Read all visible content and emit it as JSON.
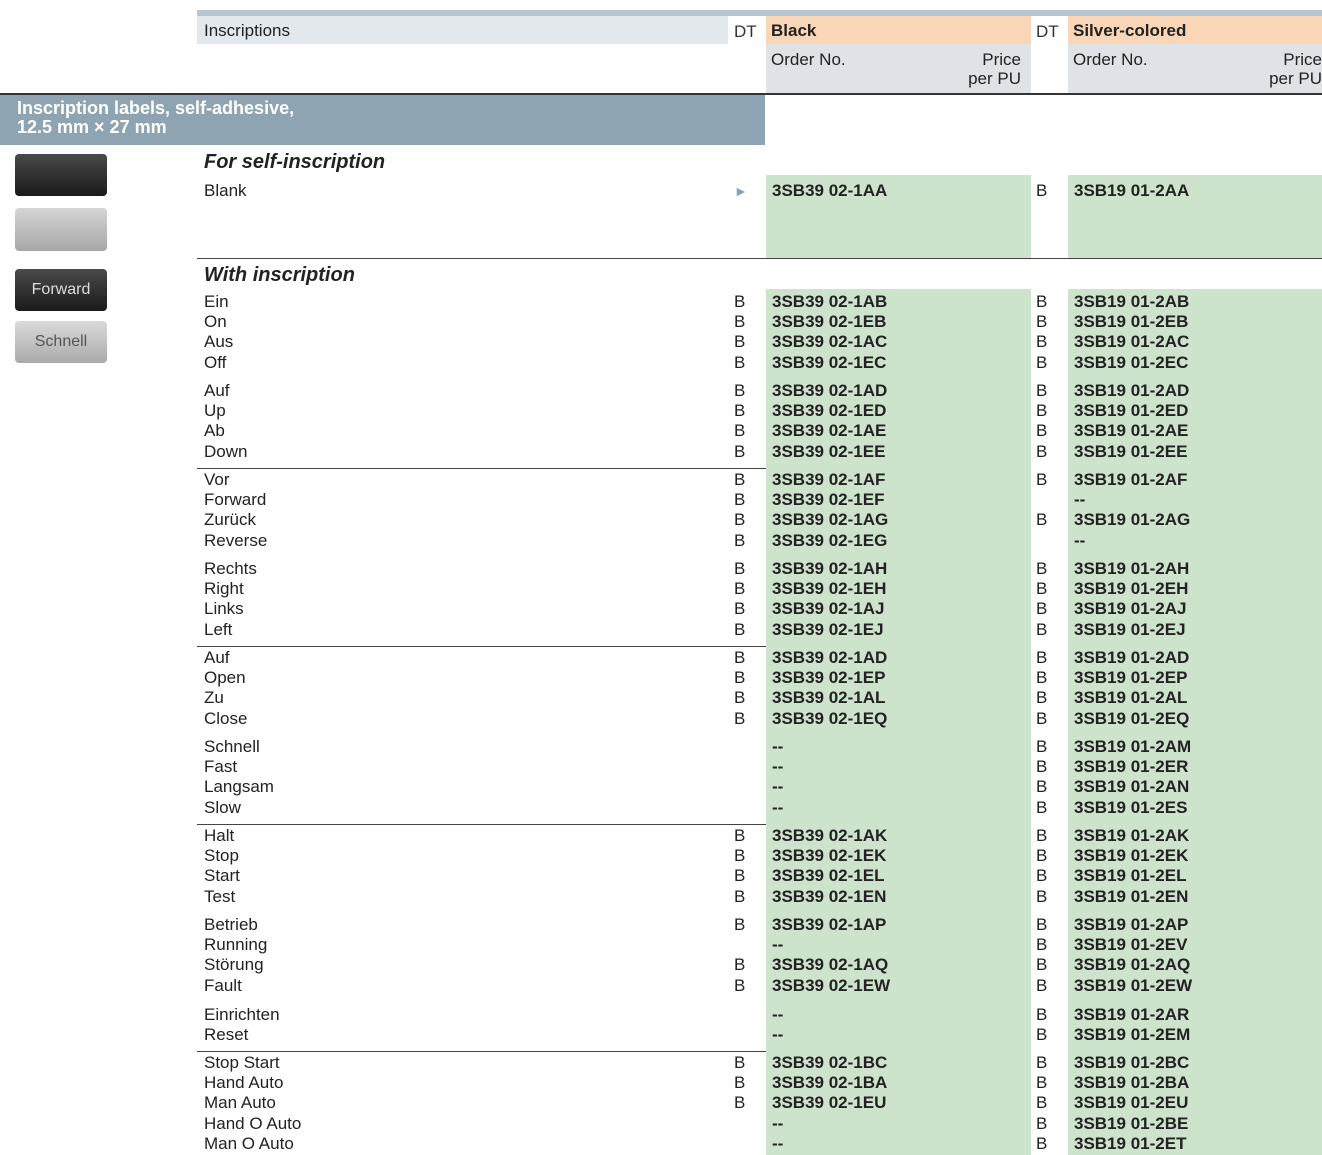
{
  "header": {
    "inscriptions_label": "Inscriptions",
    "dt_label": "DT",
    "black_label": "Black",
    "silver_label": "Silver-colored",
    "order_no_label": "Order No.",
    "price_label_line1": "Price",
    "price_label_line2": "per PU"
  },
  "section": {
    "title_line1": "Inscription labels, self-adhesive,",
    "title_line2": "12.5 mm × 27 mm"
  },
  "swatches": {
    "forward_label": "Forward",
    "schnell_label": "Schnell"
  },
  "self_inscription": {
    "heading": "For self-inscription",
    "row": {
      "label": "Blank",
      "dt_black": "►",
      "black": "3SB39 02-1AA",
      "dt_silver": "B",
      "silver": "3SB19 01-2AA"
    }
  },
  "with_inscription": {
    "heading": "With inscription",
    "rows": [
      {
        "label": "Ein",
        "dt_black": "B",
        "black": "3SB39 02-1AB",
        "dt_silver": "B",
        "silver": "3SB19 01-2AB"
      },
      {
        "label": "On",
        "dt_black": "B",
        "black": "3SB39 02-1EB",
        "dt_silver": "B",
        "silver": "3SB19 01-2EB"
      },
      {
        "label": "Aus",
        "dt_black": "B",
        "black": "3SB39 02-1AC",
        "dt_silver": "B",
        "silver": "3SB19 01-2AC"
      },
      {
        "label": "Off",
        "dt_black": "B",
        "black": "3SB39 02-1EC",
        "dt_silver": "B",
        "silver": "3SB19 01-2EC"
      },
      {
        "label": "Auf",
        "dt_black": "B",
        "black": "3SB39 02-1AD",
        "dt_silver": "B",
        "silver": "3SB19 01-2AD"
      },
      {
        "label": "Up",
        "dt_black": "B",
        "black": "3SB39 02-1ED",
        "dt_silver": "B",
        "silver": "3SB19 01-2ED"
      },
      {
        "label": "Ab",
        "dt_black": "B",
        "black": "3SB39 02-1AE",
        "dt_silver": "B",
        "silver": "3SB19 01-2AE"
      },
      {
        "label": "Down",
        "dt_black": "B",
        "black": "3SB39 02-1EE",
        "dt_silver": "B",
        "silver": "3SB19 01-2EE"
      },
      {
        "label": "Vor",
        "dt_black": "B",
        "black": "3SB39 02-1AF",
        "dt_silver": "B",
        "silver": "3SB19 01-2AF"
      },
      {
        "label": "Forward",
        "dt_black": "B",
        "black": "3SB39 02-1EF",
        "dt_silver": "",
        "silver": "--"
      },
      {
        "label": "Zurück",
        "dt_black": "B",
        "black": "3SB39 02-1AG",
        "dt_silver": "B",
        "silver": "3SB19 01-2AG"
      },
      {
        "label": "Reverse",
        "dt_black": "B",
        "black": "3SB39 02-1EG",
        "dt_silver": "",
        "silver": "--"
      },
      {
        "label": "Rechts",
        "dt_black": "B",
        "black": "3SB39 02-1AH",
        "dt_silver": "B",
        "silver": "3SB19 01-2AH"
      },
      {
        "label": "Right",
        "dt_black": "B",
        "black": "3SB39 02-1EH",
        "dt_silver": "B",
        "silver": "3SB19 01-2EH"
      },
      {
        "label": "Links",
        "dt_black": "B",
        "black": "3SB39 02-1AJ",
        "dt_silver": "B",
        "silver": "3SB19 01-2AJ"
      },
      {
        "label": "Left",
        "dt_black": "B",
        "black": "3SB39 02-1EJ",
        "dt_silver": "B",
        "silver": "3SB19 01-2EJ"
      },
      {
        "label": "Auf",
        "dt_black": "B",
        "black": "3SB39 02-1AD",
        "dt_silver": "B",
        "silver": "3SB19 01-2AD"
      },
      {
        "label": "Open",
        "dt_black": "B",
        "black": "3SB39 02-1EP",
        "dt_silver": "B",
        "silver": "3SB19 01-2EP"
      },
      {
        "label": "Zu",
        "dt_black": "B",
        "black": "3SB39 02-1AL",
        "dt_silver": "B",
        "silver": "3SB19 01-2AL"
      },
      {
        "label": "Close",
        "dt_black": "B",
        "black": "3SB39 02-1EQ",
        "dt_silver": "B",
        "silver": "3SB19 01-2EQ"
      },
      {
        "label": "Schnell",
        "dt_black": "",
        "black": "--",
        "dt_silver": "B",
        "silver": "3SB19 01-2AM"
      },
      {
        "label": "Fast",
        "dt_black": "",
        "black": "--",
        "dt_silver": "B",
        "silver": "3SB19 01-2ER"
      },
      {
        "label": "Langsam",
        "dt_black": "",
        "black": "--",
        "dt_silver": "B",
        "silver": "3SB19 01-2AN"
      },
      {
        "label": "Slow",
        "dt_black": "",
        "black": "--",
        "dt_silver": "B",
        "silver": "3SB19 01-2ES"
      },
      {
        "label": "Halt",
        "dt_black": "B",
        "black": "3SB39 02-1AK",
        "dt_silver": "B",
        "silver": "3SB19 01-2AK"
      },
      {
        "label": "Stop",
        "dt_black": "B",
        "black": "3SB39 02-1EK",
        "dt_silver": "B",
        "silver": "3SB19 01-2EK"
      },
      {
        "label": "Start",
        "dt_black": "B",
        "black": "3SB39 02-1EL",
        "dt_silver": "B",
        "silver": "3SB19 01-2EL"
      },
      {
        "label": "Test",
        "dt_black": "B",
        "black": "3SB39 02-1EN",
        "dt_silver": "B",
        "silver": "3SB19 01-2EN"
      },
      {
        "label": "Betrieb",
        "dt_black": "B",
        "black": "3SB39 02-1AP",
        "dt_silver": "B",
        "silver": "3SB19 01-2AP"
      },
      {
        "label": "Running",
        "dt_black": "",
        "black": "--",
        "dt_silver": "B",
        "silver": "3SB19 01-2EV"
      },
      {
        "label": "Störung",
        "dt_black": "B",
        "black": "3SB39 02-1AQ",
        "dt_silver": "B",
        "silver": "3SB19 01-2AQ"
      },
      {
        "label": "Fault",
        "dt_black": "B",
        "black": "3SB39 02-1EW",
        "dt_silver": "B",
        "silver": "3SB19 01-2EW"
      },
      {
        "label": "Einrichten",
        "dt_black": "",
        "black": "--",
        "dt_silver": "B",
        "silver": "3SB19 01-2AR"
      },
      {
        "label": "Reset",
        "dt_black": "",
        "black": "--",
        "dt_silver": "B",
        "silver": "3SB19 01-2EM"
      },
      {
        "label": "Stop Start",
        "dt_black": "B",
        "black": "3SB39 02-1BC",
        "dt_silver": "B",
        "silver": "3SB19 01-2BC"
      },
      {
        "label": "Hand Auto",
        "dt_black": "B",
        "black": "3SB39 02-1BA",
        "dt_silver": "B",
        "silver": "3SB19 01-2BA"
      },
      {
        "label": "Man Auto",
        "dt_black": "B",
        "black": "3SB39 02-1EU",
        "dt_silver": "B",
        "silver": "3SB19 01-2EU"
      },
      {
        "label": "Hand O Auto",
        "dt_black": "",
        "black": "--",
        "dt_silver": "B",
        "silver": "3SB19 01-2BE"
      },
      {
        "label": "Man O Auto",
        "dt_black": "",
        "black": "--",
        "dt_silver": "B",
        "silver": "3SB19 01-2ET"
      }
    ]
  }
}
